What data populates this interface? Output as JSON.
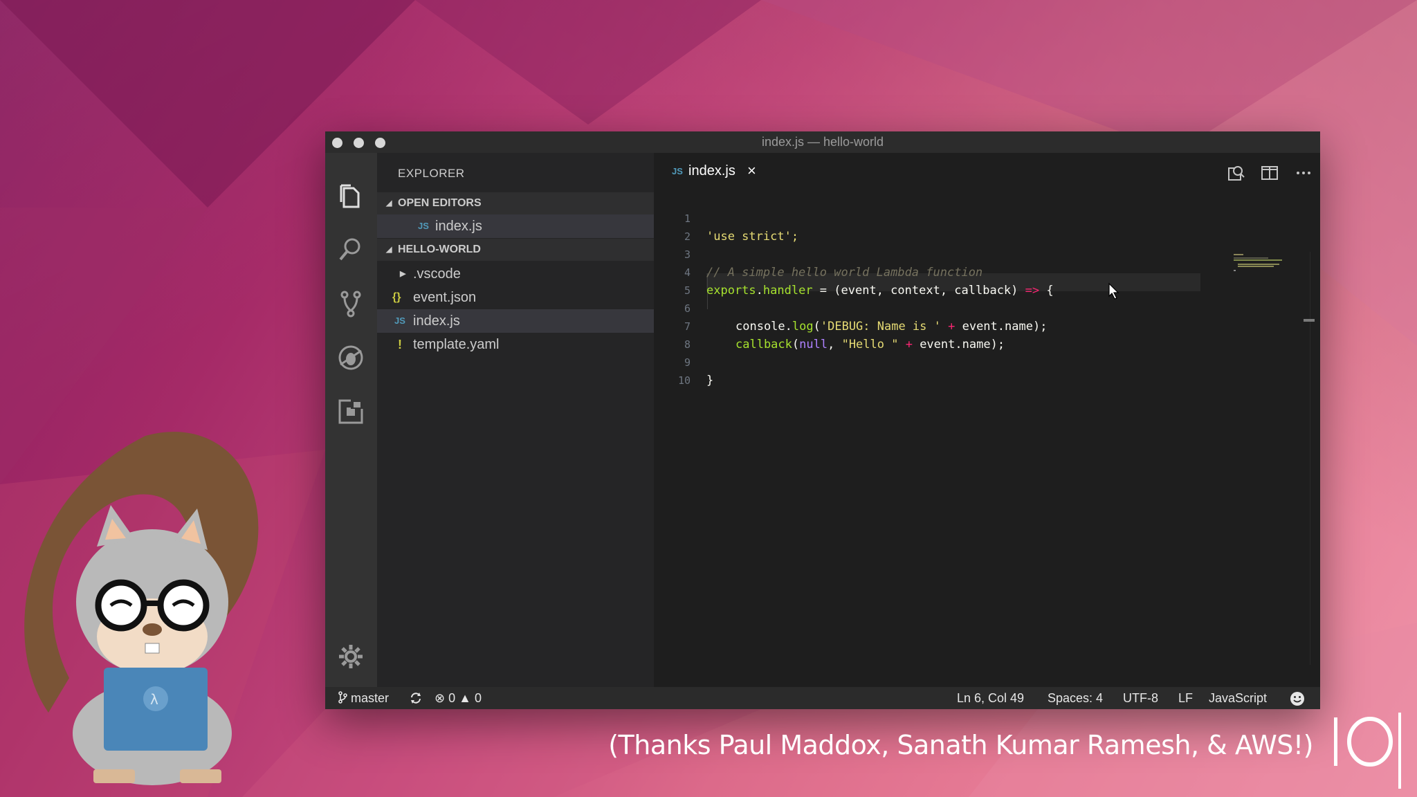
{
  "window": {
    "title": "index.js — hello-world"
  },
  "activity_bar": {
    "icons": [
      "explorer-icon",
      "search-icon",
      "source-control-icon",
      "debug-icon",
      "extensions-icon",
      "settings-gear-icon"
    ]
  },
  "sidebar": {
    "header": "EXPLORER",
    "open_editors": {
      "label": "OPEN EDITORS",
      "items": [
        {
          "label": "index.js",
          "icon": "js-file-icon",
          "badge": "JS"
        }
      ]
    },
    "project": {
      "label": "HELLO-WORLD",
      "items": [
        {
          "label": ".vscode",
          "icon": "folder-chevron-icon"
        },
        {
          "label": "event.json",
          "icon": "json-file-icon",
          "badge": "{}"
        },
        {
          "label": "index.js",
          "icon": "js-file-icon",
          "badge": "JS",
          "selected": true
        },
        {
          "label": "template.yaml",
          "icon": "yaml-file-icon",
          "badge": "!"
        }
      ]
    }
  },
  "tab": {
    "badge": "JS",
    "label": "index.js",
    "close": "×"
  },
  "editor": {
    "line_numbers": [
      "1",
      "2",
      "3",
      "4",
      "5",
      "6",
      "7",
      "8",
      "9",
      "10"
    ],
    "l1": "'use strict';",
    "l3": "// A simple hello world Lambda function",
    "l4_a": "exports",
    "l4_b": ".",
    "l4_c": "handler",
    "l4_d": " = ",
    "l4_e": "(",
    "l4_f": "event, context, callback",
    "l4_g": ") ",
    "l4_h": "=>",
    "l4_i": " {",
    "l6_a": "console",
    "l6_b": ".",
    "l6_c": "log",
    "l6_d": "(",
    "l6_e": "'DEBUG: Name is '",
    "l6_f": " + ",
    "l6_g": "event",
    "l6_h": ".",
    "l6_i": "name",
    "l6_j": ");",
    "l7_a": "callback",
    "l7_b": "(",
    "l7_c": "null",
    "l7_d": ", ",
    "l7_e": "\"Hello \"",
    "l7_f": " + ",
    "l7_g": "event",
    "l7_h": ".",
    "l7_i": "name",
    "l7_j": ");",
    "l9": "}"
  },
  "status_bar": {
    "branch": "master",
    "errors": "0",
    "warnings": "0",
    "cursor": "Ln 6, Col 49",
    "spaces": "Spaces: 4",
    "encoding": "UTF-8",
    "eol": "LF",
    "language": "JavaScript"
  },
  "caption": "(Thanks Paul Maddox, Sanath Kumar Ramesh, & AWS!)",
  "colors": {
    "accent_js": "#519aba",
    "background_pink": "#c64a7c"
  }
}
